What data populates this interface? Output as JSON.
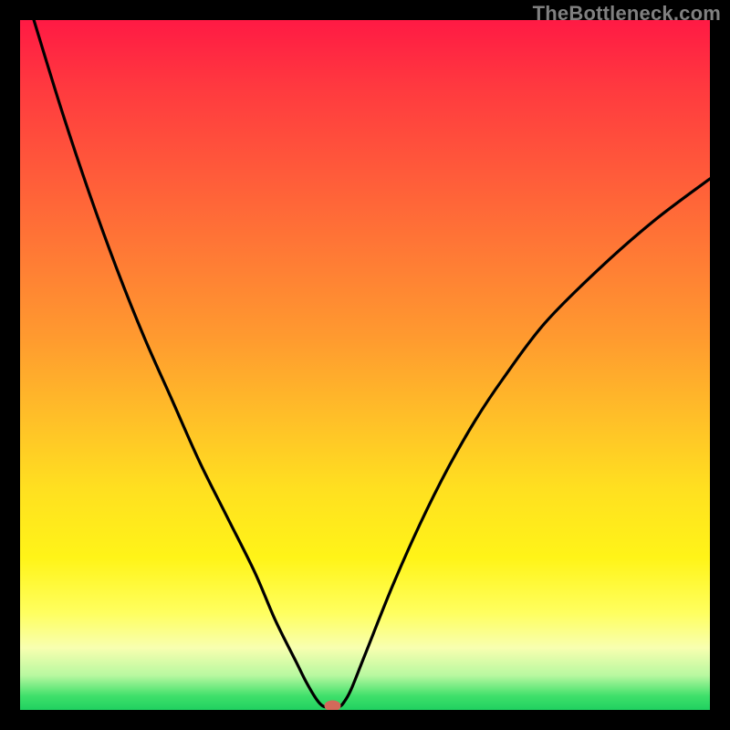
{
  "attribution": "TheBottleneck.com",
  "chart_data": {
    "type": "line",
    "title": "",
    "xlabel": "",
    "ylabel": "",
    "xlim": [
      0,
      100
    ],
    "ylim": [
      0,
      100
    ],
    "grid": false,
    "series": [
      {
        "name": "curve",
        "x": [
          2,
          6,
          10,
          14,
          18,
          22,
          26,
          30,
          34,
          37,
          40,
          41.5,
          43,
          44,
          45,
          46.3,
          47,
          48,
          50,
          54,
          58,
          62,
          66,
          70,
          76,
          84,
          92,
          100
        ],
        "y": [
          100,
          87,
          75,
          64,
          54,
          45,
          36,
          28,
          20,
          13,
          7,
          4,
          1.5,
          0.5,
          0.5,
          0.5,
          1.2,
          3,
          8,
          18,
          27,
          35,
          42,
          48,
          56,
          64,
          71,
          77
        ]
      }
    ],
    "marker": {
      "x": 45.3,
      "y": 0.6,
      "color": "#d36a5a",
      "rx": 9,
      "ry": 6
    }
  },
  "layout": {
    "outer": 800,
    "inner_offset": 22,
    "inner_size": 756
  }
}
